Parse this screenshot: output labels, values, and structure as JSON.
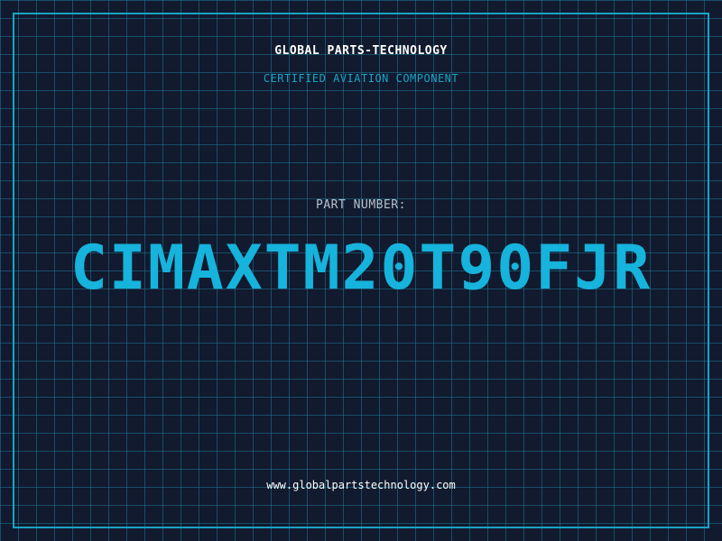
{
  "header": {
    "brand": "GLOBAL PARTS-TECHNOLOGY",
    "subtitle": "CERTIFIED AVIATION COMPONENT"
  },
  "part": {
    "label": "PART NUMBER:",
    "number": "CIMAXTM20T90FJR"
  },
  "footer": {
    "website": "www.globalpartstechnology.com"
  },
  "colors": {
    "background": "#111a2e",
    "grid": "#1e7896",
    "accent": "#1aa3c6",
    "part_number": "#16b3dc",
    "label": "#b8c0cc",
    "text": "#ffffff"
  }
}
